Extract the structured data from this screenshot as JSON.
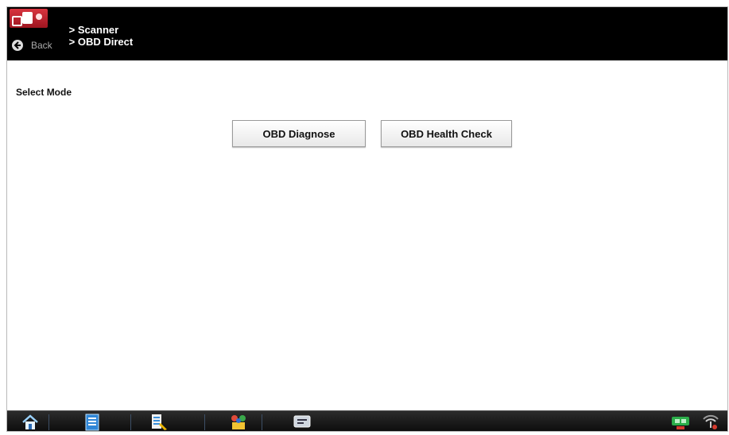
{
  "header": {
    "breadcrumb": [
      "> Scanner",
      "> OBD Direct"
    ],
    "back_label": "Back",
    "icons": [
      "app-logo",
      "back-arrow-icon"
    ]
  },
  "main": {
    "title": "Select Mode",
    "buttons": [
      "OBD Diagnose",
      "OBD Health Check"
    ]
  },
  "taskbar": {
    "icons": [
      "home-icon",
      "list-icon",
      "data-manager-icon",
      "shop-tools-icon",
      "viewer-icon",
      "connection-icon",
      "signal-icon"
    ]
  },
  "colors": {
    "header_bg": "#000000",
    "logo_red": "#c2202b",
    "taskbar_bg": "#141414"
  }
}
